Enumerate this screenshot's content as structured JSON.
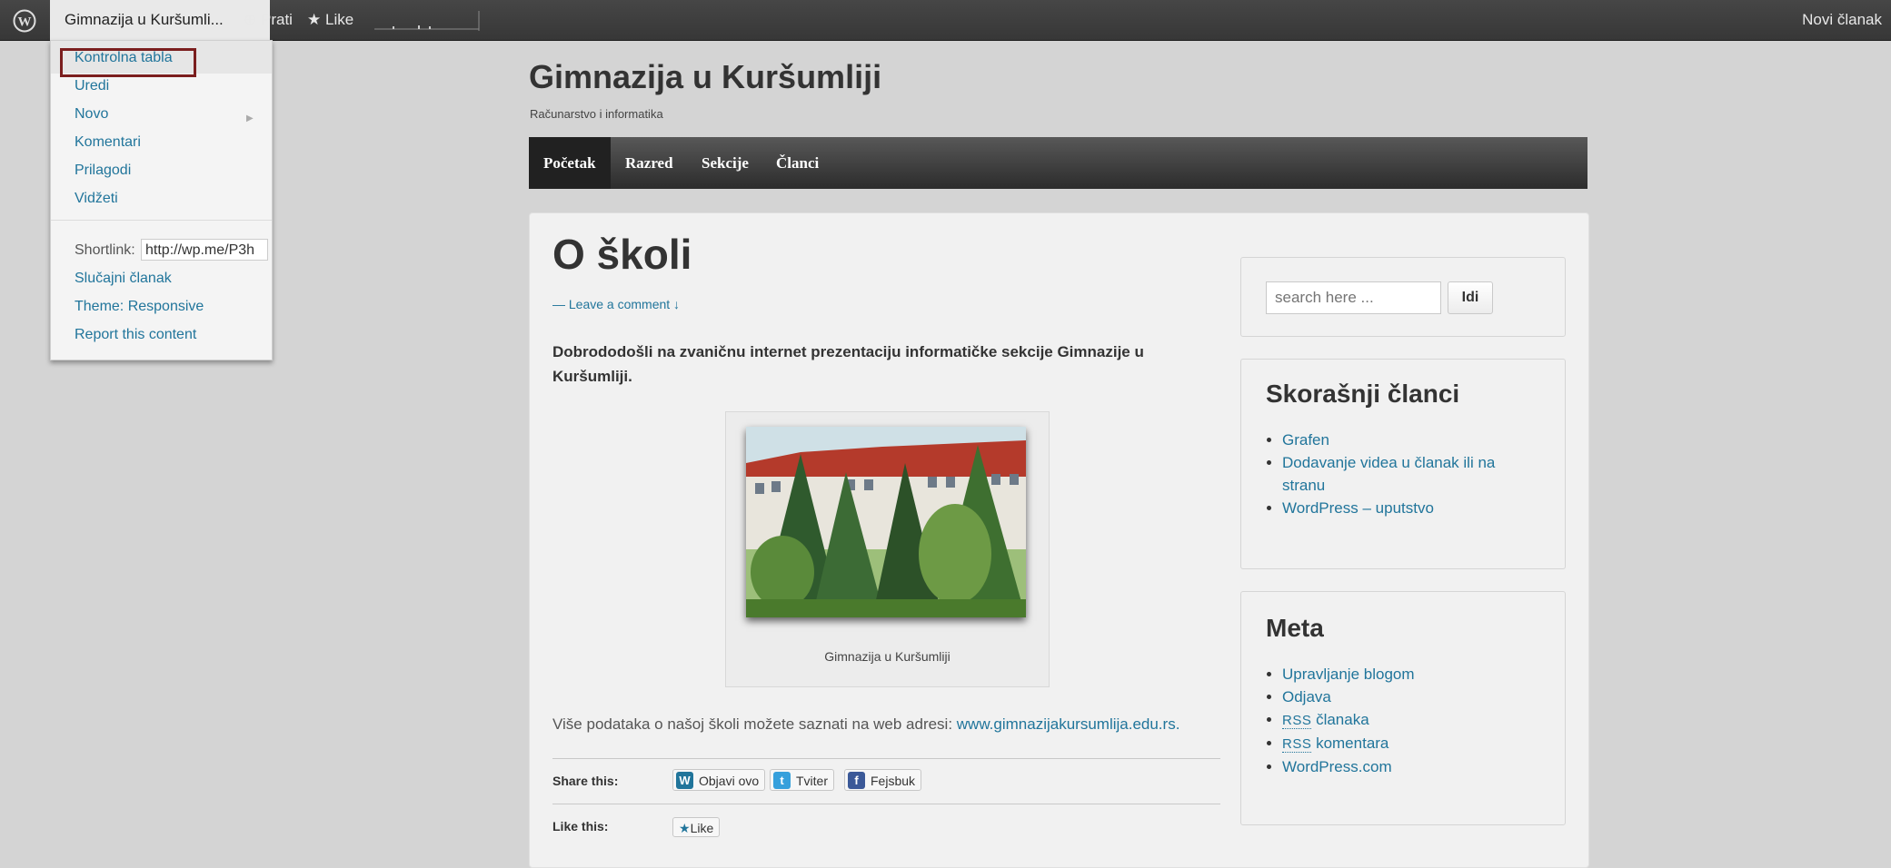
{
  "admin_bar": {
    "site_name": "Gimnazija u Kuršumli...",
    "follow_label": "Prati",
    "like_label": "Like",
    "new_post_label": "Novi članak",
    "menu": {
      "items": [
        "Kontrolna tabla",
        "Uredi",
        "Novo",
        "Komentari",
        "Prilagodi",
        "Vidžeti"
      ],
      "shortlink_label": "Shortlink:",
      "shortlink_value": "http://wp.me/P3h",
      "random_post": "Slučajni članak",
      "theme": "Theme: Responsive",
      "report": "Report this content"
    }
  },
  "site": {
    "title": "Gimnazija u Kuršumliji",
    "description": "Računarstvo i informatika"
  },
  "nav": [
    "Početak",
    "Razred",
    "Sekcije",
    "Članci"
  ],
  "post": {
    "title": "O školi",
    "comment_link": "— Leave a comment ↓",
    "intro": "Dobrododošli na zvaničnu internet prezentaciju informatičke sekcije Gimnazije u Kuršumliji.",
    "image_caption": "Gimnazija u Kuršumliji",
    "more_info_text": "Više podataka o našoj školi možete saznati na web adresi: ",
    "more_info_link": "www.gimnazijakursumlija.edu.rs.",
    "share_label": "Share this:",
    "share_buttons": [
      "Objavi ovo",
      "Tviter",
      "Fejsbuk"
    ],
    "like_label": "Like this:",
    "like_button": "Like"
  },
  "sidebar": {
    "search_placeholder": "search here ...",
    "search_button": "Idi",
    "recent_title": "Skorašnji članci",
    "recent_posts": [
      "Grafen",
      "Dodavanje videa u članak ili na stranu",
      "WordPress – uputstvo"
    ],
    "meta_title": "Meta",
    "meta": {
      "manage": "Upravljanje blogom",
      "logout": "Odjava",
      "rss_abbr": "RSS",
      "rss_posts": " članaka",
      "rss_comments": " komentara",
      "wordpress": "WordPress.com"
    }
  },
  "colors": {
    "link": "#21759b",
    "menu_highlight_border": "#7b1e1e",
    "nav_bg": "#2c2c2c"
  }
}
